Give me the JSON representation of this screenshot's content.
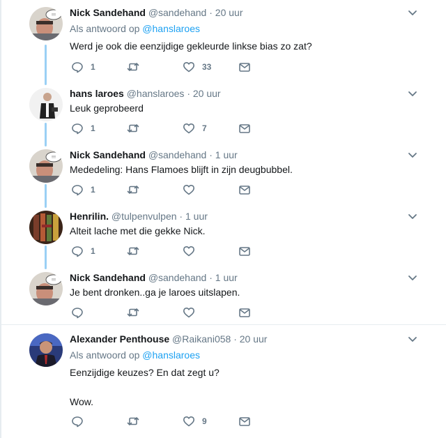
{
  "tweets": [
    {
      "name": "Nick Sandehand",
      "handle": "@sandehand",
      "dot": "·",
      "time": "20 uur",
      "reply_prefix": "Als antwoord op",
      "reply_mention": "@hanslaroes",
      "text": "Werd je ook die eenzijdige gekleurde linkse bias zo zat?",
      "reply_count": "1",
      "retweet_count": "",
      "like_count": "33",
      "avatar": "nick-avatar"
    },
    {
      "name": "hans laroes",
      "handle": "@hanslaroes",
      "dot": "·",
      "time": "20 uur",
      "text": "Leuk geprobeerd",
      "reply_count": "1",
      "retweet_count": "",
      "like_count": "7",
      "avatar": "hans-avatar"
    },
    {
      "name": "Nick Sandehand",
      "handle": "@sandehand",
      "dot": "·",
      "time": "1 uur",
      "text": "Mededeling: Hans Flamoes blijft in zijn deugbubbel.",
      "reply_count": "1",
      "retweet_count": "",
      "like_count": "",
      "avatar": "nick-avatar"
    },
    {
      "name": "Henrilin.",
      "handle": "@tulpenvulpen",
      "dot": "·",
      "time": "1 uur",
      "text": "Alteit lache met die gekke Nick.",
      "reply_count": "1",
      "retweet_count": "",
      "like_count": "",
      "avatar": "henrilin-avatar"
    },
    {
      "name": "Nick Sandehand",
      "handle": "@sandehand",
      "dot": "·",
      "time": "1 uur",
      "text": "Je bent dronken..ga je laroes uitslapen.",
      "reply_count": "",
      "retweet_count": "",
      "like_count": "",
      "avatar": "nick-avatar"
    },
    {
      "name": "Alexander Penthouse",
      "handle": "@Raikani058",
      "dot": "·",
      "time": "20 uur",
      "reply_prefix": "Als antwoord op",
      "reply_mention": "@hanslaroes",
      "text": "Eenzijdige keuzes? En dat zegt u?",
      "text2": "Wow.",
      "reply_count": "",
      "retweet_count": "",
      "like_count": "9",
      "avatar": "alexander-avatar"
    }
  ],
  "colors": {
    "thread_line": "#9ad0f5",
    "secondary_text": "#657786",
    "link": "#1da1f2",
    "primary_text": "#14171a"
  },
  "icons": [
    "reply-icon",
    "retweet-icon",
    "like-icon",
    "direct-message-icon",
    "chevron-down-icon"
  ]
}
